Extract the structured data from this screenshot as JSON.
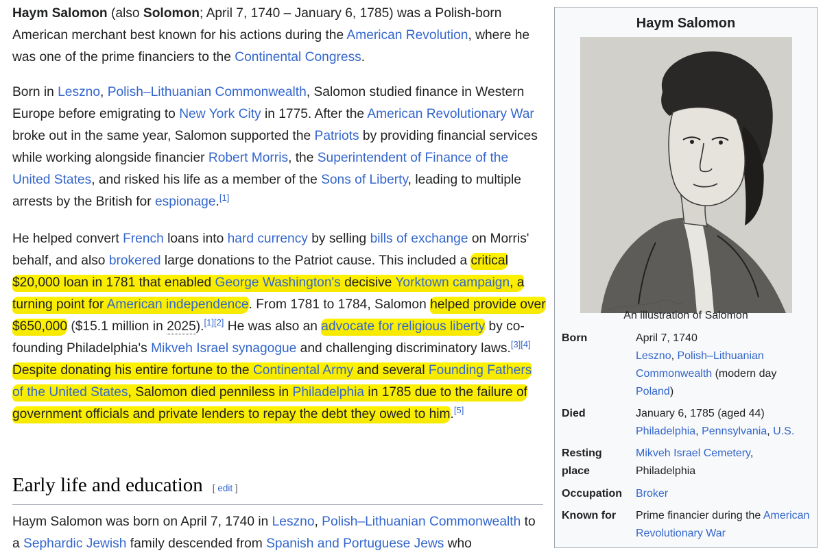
{
  "p1": {
    "name_bold": "Haym Salomon",
    "t1": " (also ",
    "alt_bold": "Solomon",
    "t2": "; April 7, 1740 – January 6, 1785) was a Polish-born American merchant best known for his actions during the ",
    "l1": "American Revolution",
    "t3": ", where he was one of the prime financiers to the ",
    "l2": "Continental Congress",
    "t4": "."
  },
  "p2": {
    "t1": "Born in ",
    "l1": "Leszno",
    "t2": ", ",
    "l2": "Polish–Lithuanian Commonwealth",
    "t3": ", Salomon studied finance in Western Europe before emigrating to ",
    "l3": "New York City",
    "t4": " in 1775. After the ",
    "l4": "American Revolutionary War",
    "t5": " broke out in the same year, Salomon supported the ",
    "l5": "Patriots",
    "t6": " by providing financial services while working alongside financier ",
    "l6": "Robert Morris",
    "t7": ", the ",
    "l7": "Superintendent of Finance of the United States",
    "t8": ", and risked his life as a member of the ",
    "l8": "Sons of Liberty",
    "t9": ", leading to multiple arrests by the British for ",
    "l9": "espionage",
    "t10": ".",
    "r1": "[1]"
  },
  "p3": {
    "t1": "He helped convert ",
    "l1": "French",
    "t2": " loans into ",
    "l2": "hard currency",
    "t3": " by selling ",
    "l3": "bills of exchange",
    "t4": " on Morris' behalf, and also ",
    "l4": "brokered",
    "t5": " large donations to the Patriot cause. This included a ",
    "h1a": "critical $20,000 loan in 1781 that enabled ",
    "h1l1": "George Washington's",
    "h1b": " decisive ",
    "h1l2": "Yorktown campaign",
    "h1c": ", a turning point for ",
    "h1l3": "American independence",
    "t6": ". From 1781 to 1784, Salomon ",
    "h2": "helped provide over $650,000",
    "t7": " ($15.1 million in ",
    "year": "2025",
    "t8": ").",
    "r1": "[1]",
    "r2": "[2]",
    "t9": " He was also an ",
    "h3": "advocate for religious liberty",
    "t10": " by co-founding Philadelphia's ",
    "l5": "Mikveh Israel synagogue",
    "t11": " and challenging discriminatory laws.",
    "r3": "[3]",
    "r4": "[4]",
    "t12": " ",
    "h4a": "Despite donating his entire fortune to the ",
    "h4l1": "Continental Army",
    "h4b": " and several ",
    "h4l2": "Founding Fathers of the United States",
    "h4c": ", Salomon died penniless in ",
    "h4l3": "Philadelphia",
    "h4d": " in 1785 due to the failure of government officials and private lenders to repay the debt they owed to him",
    "t13": ".",
    "r5": "[5]"
  },
  "section": {
    "heading": "Early life and education",
    "edit_open": "[ ",
    "edit_label": "edit",
    "edit_close": " ]"
  },
  "p4": {
    "t1": "Haym Salomon was born on April 7, 1740 in ",
    "l1": "Leszno",
    "t2": ", ",
    "l2": "Polish–Lithuanian Commonwealth",
    "t3": " to a ",
    "l3": "Sephardic Jewish",
    "t4": " family descended from ",
    "l4": "Spanish and Portuguese Jews",
    "t5": " who"
  },
  "infobox": {
    "title": "Haym Salomon",
    "caption": "An illustration of Salomon",
    "born_label": "Born",
    "born_date": "April 7, 1740",
    "born_l1": "Leszno",
    "born_sep": ", ",
    "born_l2": "Polish–Lithuanian Commonwealth",
    "born_t1": " (modern day ",
    "born_l3": "Poland",
    "born_t2": ")",
    "died_label": "Died",
    "died_date": "January 6, 1785 (aged 44)",
    "died_l1": "Philadelphia",
    "died_sep1": ", ",
    "died_l2": "Pennsylvania",
    "died_sep2": ", ",
    "died_l3": "U.S.",
    "rest_label": "Resting place",
    "rest_l1": "Mikveh Israel Cemetery",
    "rest_t1": ", Philadelphia",
    "occ_label": "Occupation",
    "occ_l1": "Broker",
    "known_label": "Known for",
    "known_t1": "Prime financier during the ",
    "known_l1": "American Revolutionary War"
  },
  "colors": {
    "link": "#3366cc",
    "text": "#202122",
    "highlight": "#fff200",
    "infobox_bg": "#f8f9fa",
    "border": "#a2a9b1"
  }
}
